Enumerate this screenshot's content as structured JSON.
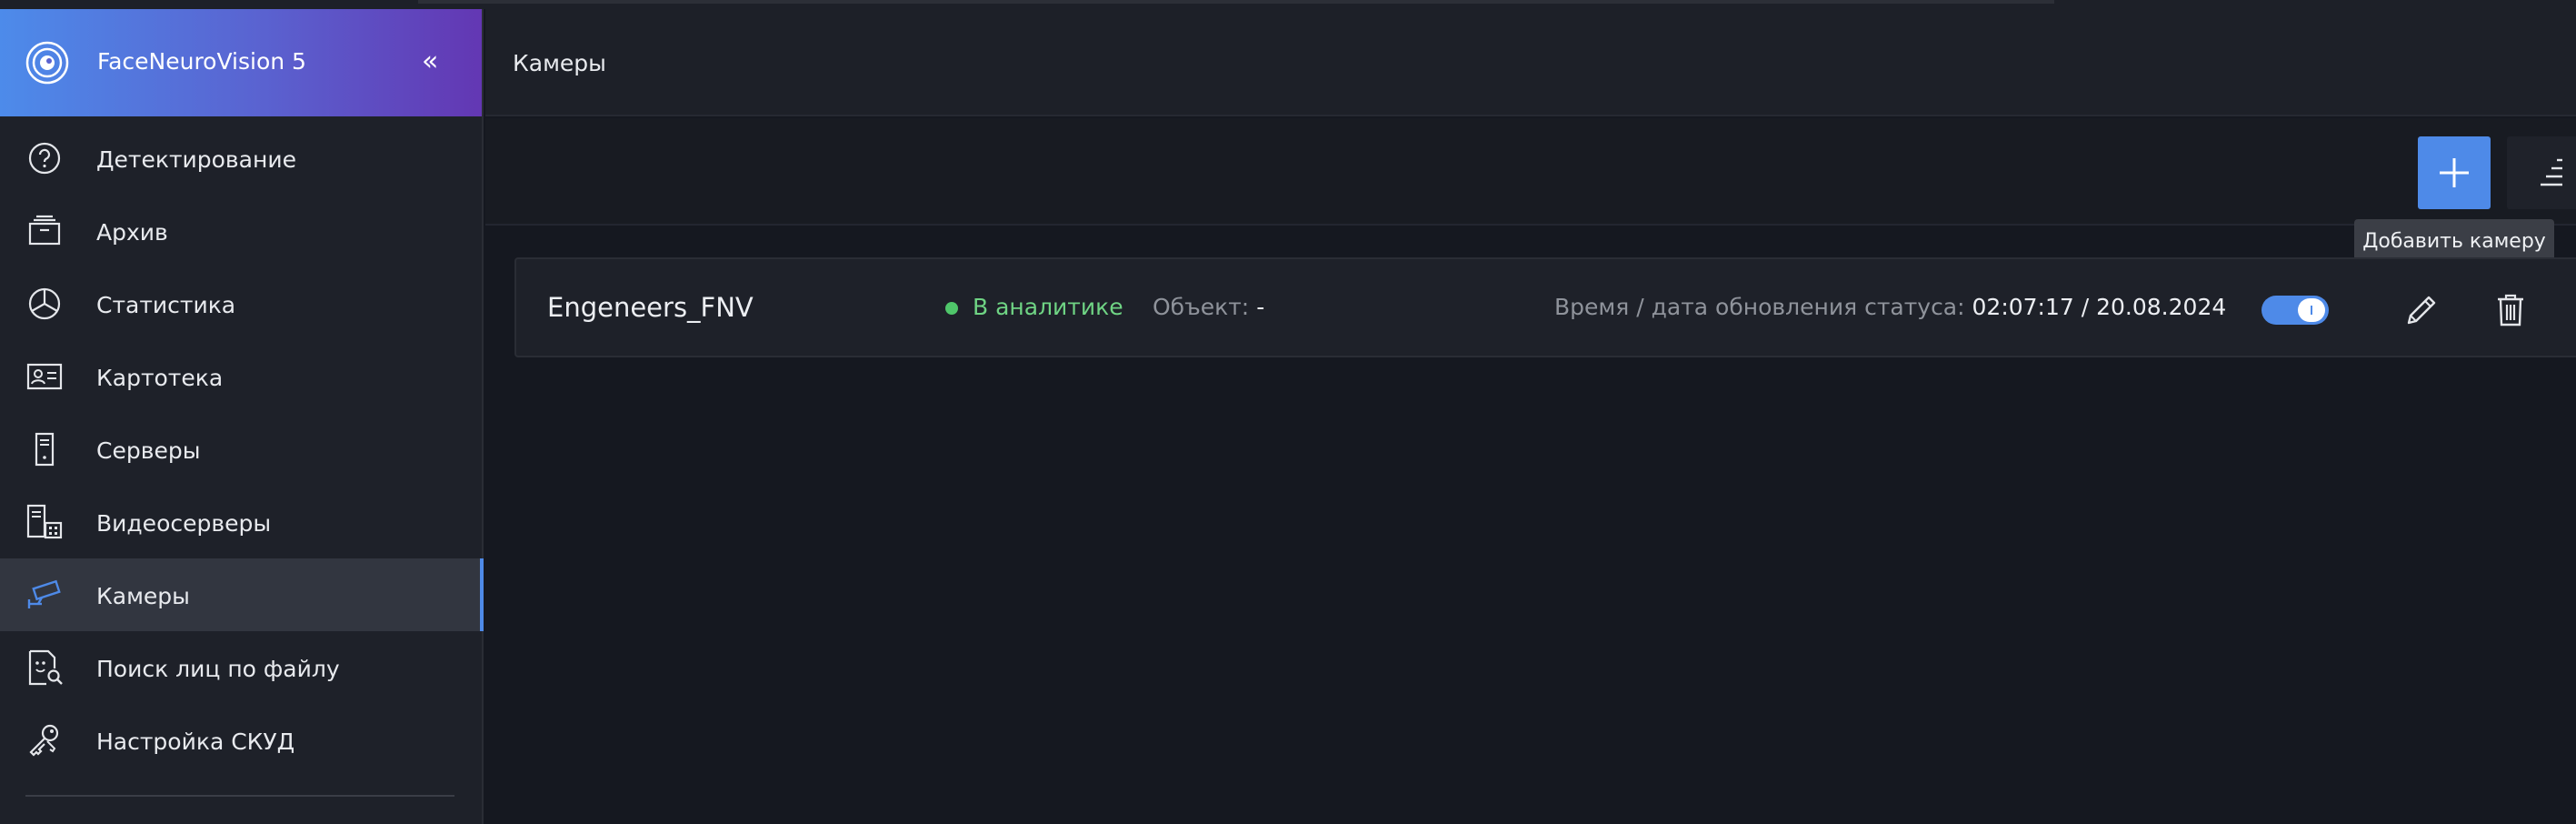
{
  "app": {
    "name": "FaceNeuroVision 5",
    "collapse_glyph": "«"
  },
  "sidebar": {
    "items": [
      {
        "label": "Детектирование",
        "icon": "question-circle-icon"
      },
      {
        "label": "Архив",
        "icon": "archive-box-icon"
      },
      {
        "label": "Статистика",
        "icon": "pie-chart-icon"
      },
      {
        "label": "Картотека",
        "icon": "id-card-icon"
      },
      {
        "label": "Серверы",
        "icon": "server-icon"
      },
      {
        "label": "Видеосерверы",
        "icon": "video-server-icon"
      },
      {
        "label": "Камеры",
        "icon": "camera-icon",
        "active": true
      },
      {
        "label": "Поиск лиц по файлу",
        "icon": "face-search-icon"
      },
      {
        "label": "Настройка СКУД",
        "icon": "keys-icon"
      }
    ]
  },
  "header": {
    "title": "Камеры"
  },
  "toolbar": {
    "add_tooltip": "Добавить камеру"
  },
  "cameras": [
    {
      "name": "Engeneers_FNV",
      "status": "В аналитике",
      "object_label": "Объект:",
      "object_value": "-",
      "updated_label": "Время / дата обновления статуса:",
      "updated_value": "02:07:17 / 20.08.2024",
      "enabled": true
    }
  ],
  "colors": {
    "accent": "#4e8ae8",
    "status_ok": "#4fc66a",
    "bg": "#151820",
    "sidebar_bg": "#1e2129"
  }
}
